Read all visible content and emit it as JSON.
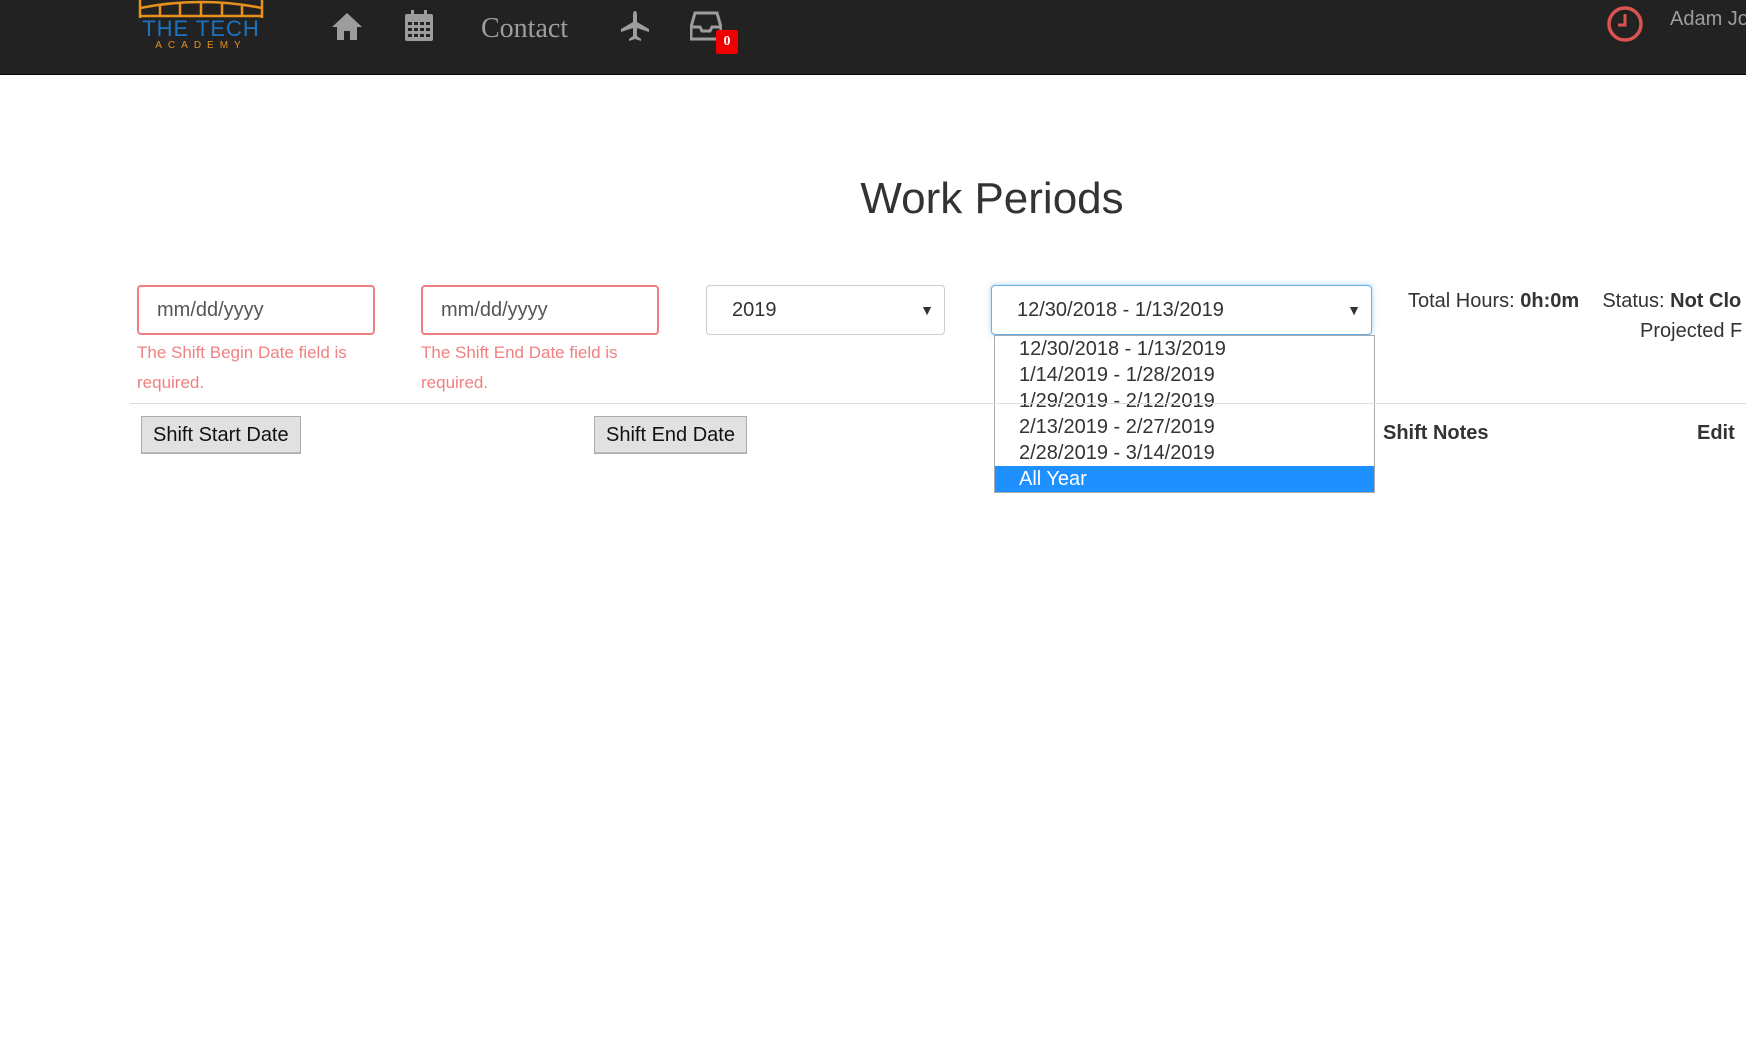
{
  "navbar": {
    "logo": {
      "line1": "THE TECH",
      "line2": "ACADEMY"
    },
    "icons": [
      "home-icon",
      "calendar-icon",
      "airplane-icon",
      "inbox-icon"
    ],
    "contact_label": "Contact",
    "inbox_badge": "0",
    "user_name": "Adam Jo"
  },
  "page_title": "Work Periods",
  "filters": {
    "shift_begin": {
      "placeholder": "mm/dd/yyyy",
      "error": "The Shift Begin Date field is required."
    },
    "shift_end": {
      "placeholder": "mm/dd/yyyy",
      "error": "The Shift End Date field is required."
    },
    "year_select": {
      "value": "2019"
    },
    "period_select": {
      "value": "12/30/2018 - 1/13/2019",
      "options": [
        "12/30/2018 - 1/13/2019",
        "1/14/2019 - 1/28/2019",
        "1/29/2019 - 2/12/2019",
        "2/13/2019 - 2/27/2019",
        "2/28/2019 - 3/14/2019",
        "All Year"
      ],
      "highlighted_option": "All Year"
    }
  },
  "summary": {
    "total_hours_label": "Total Hours:",
    "total_hours_value": "0h:0m",
    "status_label": "Status:",
    "status_value": "Not Clo",
    "projected_label": "Projected F"
  },
  "table": {
    "sort_buttons": {
      "start": "Shift Start Date",
      "end": "Shift End Date"
    },
    "headers": {
      "notes": "Shift Notes",
      "edit": "Edit"
    }
  },
  "colors": {
    "navbar": "#222222",
    "error": "#f08080",
    "clock_icon": "#d9534f",
    "badge": "#ee0000",
    "selected_option": "#1e90ff"
  }
}
